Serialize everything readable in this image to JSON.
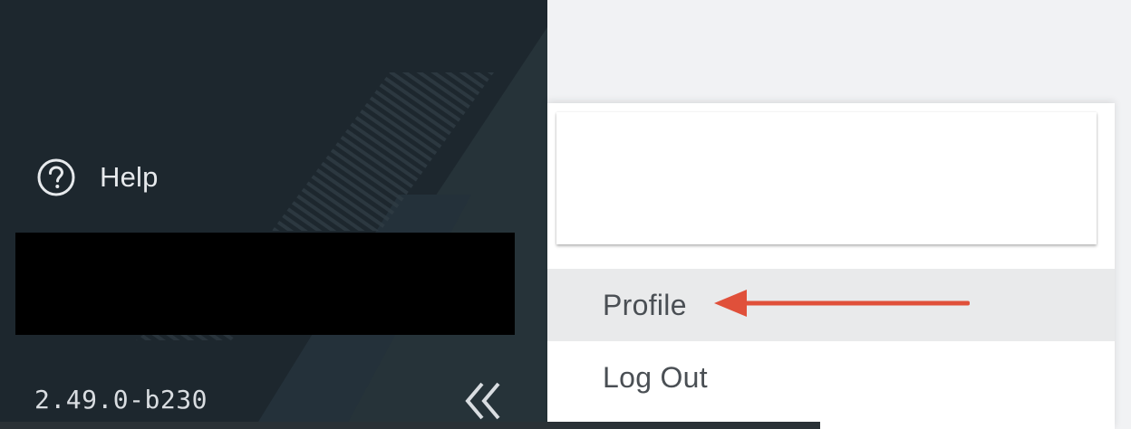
{
  "sidebar": {
    "help_label": "Help",
    "version": "2.49.0-b230",
    "icons": {
      "help": "help-circle-icon",
      "collapse": "double-chevron-left-icon"
    }
  },
  "dropdown": {
    "items": [
      {
        "label": "Profile"
      },
      {
        "label": "Log Out"
      }
    ]
  },
  "colors": {
    "sidebar_bg": "#1f2a31",
    "sidebar_text": "#e6e9ec",
    "menu_text": "#4a4f54",
    "menu_hover_bg": "#e9eaeb",
    "annotation_arrow": "#e0503a"
  }
}
